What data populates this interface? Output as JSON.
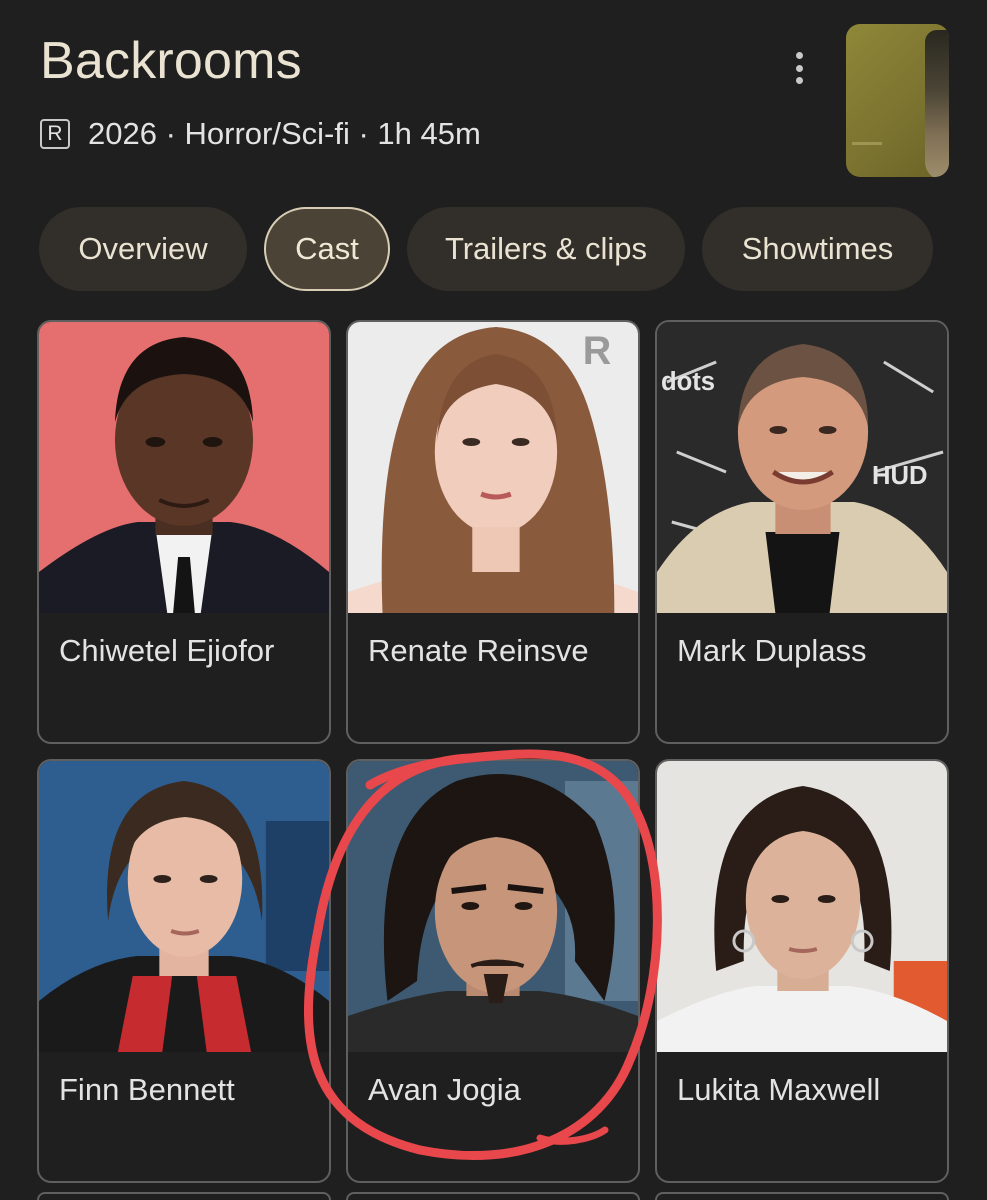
{
  "header": {
    "title": "Backrooms",
    "rating": "R",
    "details": "2026 · Horror/Sci-fi · 1h 45m"
  },
  "tabs": [
    {
      "label": "Overview",
      "active": false
    },
    {
      "label": "Cast",
      "active": true
    },
    {
      "label": "Trailers & clips",
      "active": false
    },
    {
      "label": "Showtimes",
      "active": false
    }
  ],
  "cast": [
    {
      "name": "Chiwetel Ejiofor"
    },
    {
      "name": "Renate Reinsve"
    },
    {
      "name": "Mark Duplass"
    },
    {
      "name": "Finn Bennett"
    },
    {
      "name": "Avan Jogia"
    },
    {
      "name": "Lukita Maxwell"
    }
  ],
  "colors": {
    "background": "#1f1f1f",
    "tab_bg": "#322f2b",
    "tab_active_bg": "#4b4436",
    "annotation_circle": "#e8474b"
  },
  "icons": {
    "menu": "more-vert-icon"
  }
}
